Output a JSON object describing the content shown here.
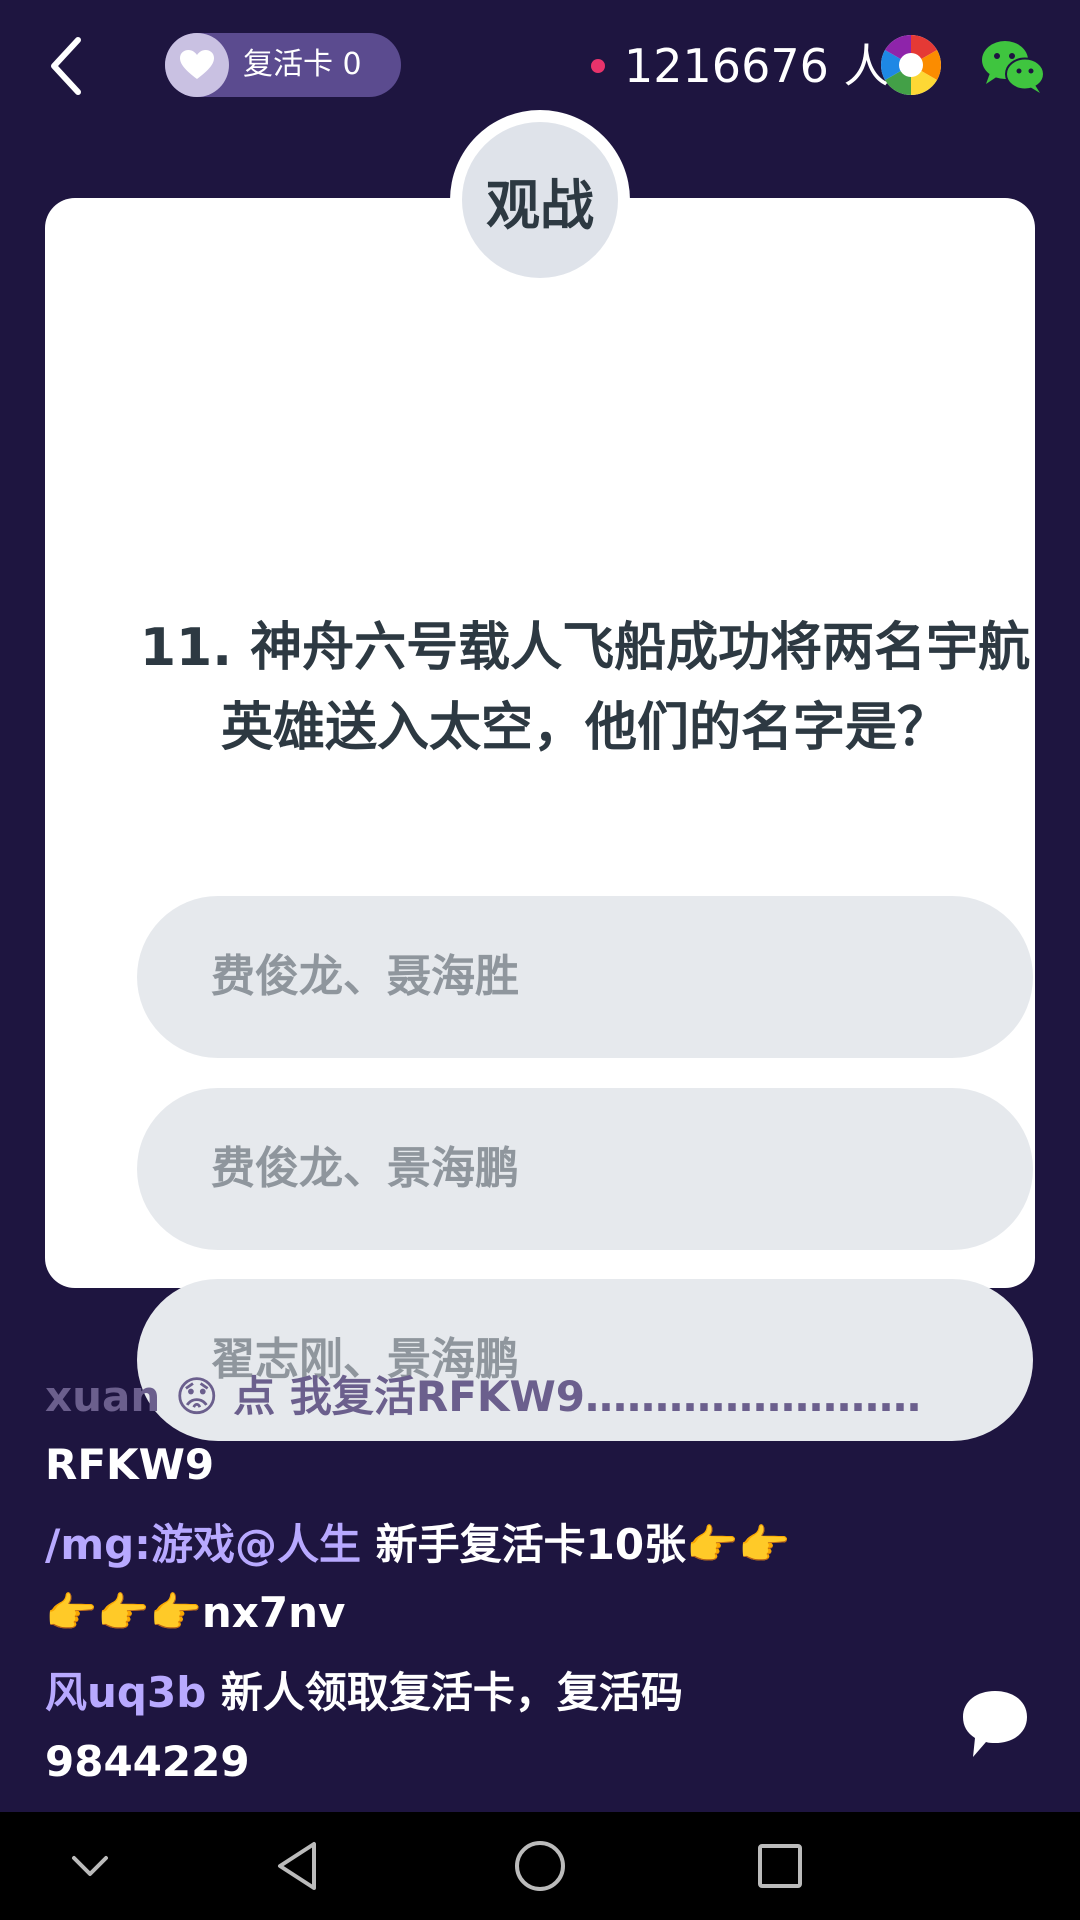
{
  "header": {
    "revive_card_label": "复活卡 0",
    "viewer_count": "1216676 人"
  },
  "card": {
    "badge": "观战",
    "question": "11. 神舟六号载人飞船成功将两名宇航英雄送入太空，他们的名字是？",
    "options": [
      "费俊龙、聂海胜",
      "费俊龙、景海鹏",
      "翟志刚、景海鹏"
    ]
  },
  "chat": {
    "line1": {
      "name": "xuan",
      "emoji": "😟",
      "text": " 点 我复活RFKW9……………………"
    },
    "line2": {
      "text": "RFKW9"
    },
    "line3": {
      "name": " /mg:游戏@人生",
      "text": " 新手复活卡10张👉👉"
    },
    "line4": {
      "text": "👉👉👉nx7nv"
    },
    "line5": {
      "name": "风uq3b",
      "text": " 新人领取复活卡，复活码"
    },
    "line6": {
      "text": "9844229"
    }
  },
  "colors": {
    "background": "#1e1540",
    "card": "#ffffff",
    "option": "#e6e9ed",
    "accent_name": "#b8a9ff",
    "live_dot": "#e8336b"
  },
  "icons": [
    "back-icon",
    "heart-icon",
    "camera-icon",
    "wechat-icon",
    "chat-bubble-icon",
    "nav-down-icon",
    "nav-back-icon",
    "nav-home-icon",
    "nav-recents-icon"
  ]
}
